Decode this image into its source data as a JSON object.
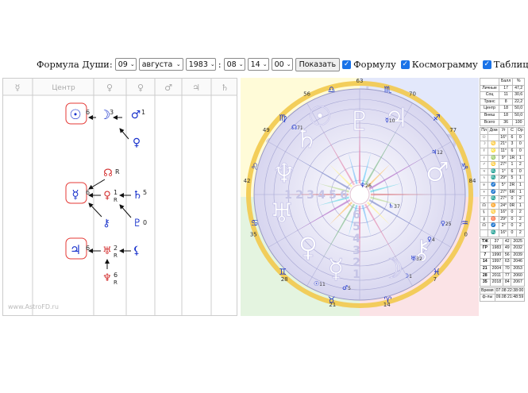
{
  "controls": {
    "label": "Формула Души:",
    "day": "09",
    "month": "августа",
    "year": "1983",
    "sep": ":",
    "hour": "08",
    "minute": "14",
    "second": "00",
    "show_button": "Показать",
    "formula_label": "Формулу",
    "cosmogram_label": "Космограмму",
    "table_label": "Таблицу"
  },
  "formula_panel": {
    "columns": [
      "☿",
      "Центр",
      "♀",
      "♀",
      "♂",
      "♃",
      "♄"
    ],
    "watermark": "www.AstroFD.ru",
    "nodes": {
      "sun_center": {
        "sym": "☉",
        "num": "6"
      },
      "moon": {
        "sym": "☽",
        "num": "3"
      },
      "mars": {
        "sym": "♂",
        "num": "1"
      },
      "venus": {
        "sym": "♀"
      },
      "node": {
        "sym": "☊",
        "num": "R"
      },
      "mercury_center": {
        "sym": "☿",
        "num": "6"
      },
      "venus2": {
        "sym": "♀",
        "num": "1",
        "retro": "R"
      },
      "saturn": {
        "sym": "♄",
        "num": "5"
      },
      "chiron": {
        "sym": "⚷"
      },
      "pluto": {
        "sym": "♇",
        "num": "0"
      },
      "jupiter_center": {
        "sym": "♃",
        "num": "6"
      },
      "uranus": {
        "sym": "♅",
        "num": "2",
        "retro": "R"
      },
      "lilith": {
        "sym": "⚸"
      },
      "neptune": {
        "sym": "♆",
        "num": "6",
        "retro": "R"
      }
    }
  },
  "cosmogram": {
    "degree_labels": [
      "63",
      "70",
      "77",
      "84",
      "0",
      "7",
      "14",
      "21",
      "28",
      "35",
      "42",
      "49",
      "56"
    ],
    "ring_numbers": [
      "1",
      "2",
      "3",
      "4",
      "5",
      "6"
    ],
    "outer_signs": [
      "♈",
      "♉",
      "♊",
      "♋",
      "♌",
      "♍",
      "♎",
      "♏",
      "♐",
      "♑",
      "♒",
      "♓"
    ],
    "big_symbols": [
      "♄",
      "♃",
      "♂",
      "♆",
      "♅",
      "♀",
      "☿",
      "☽",
      "⚷",
      "♇",
      "☉"
    ],
    "planet_labels": [
      {
        "sym": "☊",
        "deg": "71"
      },
      {
        "sym": "♆",
        "deg": "26"
      },
      {
        "sym": "♅",
        "deg": "32"
      },
      {
        "sym": "♄",
        "deg": "37"
      },
      {
        "sym": "☉",
        "deg": "11"
      },
      {
        "sym": "♀",
        "deg": "25"
      },
      {
        "sym": "☽",
        "deg": "1"
      },
      {
        "sym": "♀",
        "deg": "4"
      },
      {
        "sym": "♂",
        "deg": "5"
      },
      {
        "sym": "♃",
        "deg": "12"
      },
      {
        "sym": "☿",
        "deg": "10"
      }
    ]
  },
  "side_table": {
    "head": [
      "",
      "Балл",
      "%"
    ],
    "rows": [
      [
        "Личные",
        "17",
        "47,2"
      ],
      [
        "Соц",
        "11",
        "30,6"
      ],
      [
        "Транс",
        "8",
        "22,2"
      ],
      [
        "Центр",
        "18",
        "50,0"
      ],
      [
        "Внеш",
        "18",
        "50,0"
      ],
      [
        "Всего",
        "36",
        "100"
      ]
    ],
    "planet_head": [
      "Пл",
      "Дом",
      "Уг",
      "С",
      "Ор"
    ],
    "planets": [
      [
        "☉",
        "",
        "16°",
        "6",
        "0"
      ],
      [
        "☽",
        "♋",
        "21°",
        "3",
        "0"
      ],
      [
        "☿",
        "♌",
        "11°",
        "6",
        "0"
      ],
      [
        "♀",
        "♍",
        "9°",
        "1R",
        "1"
      ],
      [
        "♂",
        "♋",
        "27°",
        "1",
        "2"
      ],
      [
        "♃",
        "♏",
        "1°",
        "6",
        "0"
      ],
      [
        "♄",
        "♏",
        "29°",
        "5",
        "1"
      ],
      [
        "♅",
        "♐",
        "5°",
        "2R",
        "1"
      ],
      [
        "♆",
        "♐",
        "27°",
        "6R",
        "1"
      ],
      [
        "♇",
        "♏",
        "27°",
        "0",
        "2"
      ],
      [
        "☊",
        "♊",
        "24°",
        "0R",
        "1"
      ],
      [
        "⚸",
        "♋",
        "16°",
        "0",
        "2"
      ],
      [
        "⚷",
        "♉",
        "29°",
        "0",
        "2"
      ],
      [
        "☊",
        "♐",
        "2°",
        "0",
        "2"
      ],
      [
        "",
        "♏",
        "16°",
        "0",
        "2"
      ]
    ],
    "years_head": [
      "ТЖ",
      "37",
      "42",
      "2025"
    ],
    "years": [
      [
        "ГР",
        "1983",
        "49",
        "2032"
      ],
      [
        "7",
        "1990",
        "56",
        "2039"
      ],
      [
        "14",
        "1997",
        "63",
        "2046"
      ],
      [
        "21",
        "2004",
        "70",
        "2053"
      ],
      [
        "28",
        "2011",
        "77",
        "2060"
      ],
      [
        "35",
        "2018",
        "84",
        "2067"
      ]
    ],
    "time_rows": [
      [
        "Время",
        "07.08 22:38:00"
      ],
      [
        "ф-лы",
        "09.08 21:48:59"
      ]
    ]
  }
}
